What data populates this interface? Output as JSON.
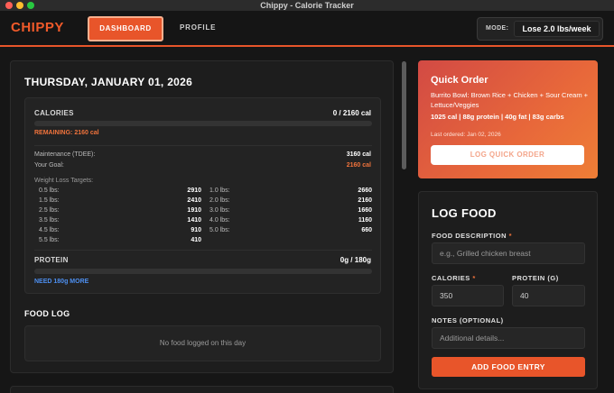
{
  "window": {
    "title": "Chippy - Calorie Tracker",
    "traffic_lights": [
      "#ff5f57",
      "#febc2e",
      "#28c840"
    ]
  },
  "header": {
    "logo": "CHIPPY",
    "nav": {
      "dashboard": "DASHBOARD",
      "profile": "PROFILE"
    },
    "mode_label": "MODE:",
    "mode_value": "Lose 2.0 lbs/week"
  },
  "dashboard": {
    "date": "THURSDAY, JANUARY 01, 2026",
    "calories": {
      "label": "CALORIES",
      "value": "0 / 2160 cal",
      "progress": 0,
      "remaining": "REMAINING: 2160 cal"
    },
    "maintenance": {
      "label": "Maintenance (TDEE):",
      "value": "3160 cal"
    },
    "goal": {
      "label": "Your Goal:",
      "value": "2160 cal"
    },
    "weight_loss": {
      "title": "Weight Loss Targets:",
      "left": [
        {
          "label": "0.5 lbs:",
          "value": "2910"
        },
        {
          "label": "1.5 lbs:",
          "value": "2410"
        },
        {
          "label": "2.5 lbs:",
          "value": "1910"
        },
        {
          "label": "3.5 lbs:",
          "value": "1410"
        },
        {
          "label": "4.5 lbs:",
          "value": "910"
        },
        {
          "label": "5.5 lbs:",
          "value": "410"
        }
      ],
      "right": [
        {
          "label": "1.0 lbs:",
          "value": "2660"
        },
        {
          "label": "2.0 lbs:",
          "value": "2160"
        },
        {
          "label": "3.0 lbs:",
          "value": "1660"
        },
        {
          "label": "4.0 lbs:",
          "value": "1160"
        },
        {
          "label": "5.0 lbs:",
          "value": "660"
        }
      ]
    },
    "protein": {
      "label": "PROTEIN",
      "value": "0g / 180g",
      "progress": 0,
      "need": "NEED 180g MORE"
    },
    "food_log": {
      "title": "FOOD LOG",
      "empty": "No food logged on this day"
    }
  },
  "quick_order": {
    "title": "Quick Order",
    "description": "Burrito Bowl: Brown Rice + Chicken + Sour Cream + Lettuce/Veggies",
    "macros": "1025 cal | 88g protein | 40g fat | 83g carbs",
    "last_ordered": "Last ordered: Jan 02, 2026",
    "button": "LOG QUICK ORDER"
  },
  "log_food": {
    "title": "LOG FOOD",
    "description_label": "FOOD DESCRIPTION",
    "description_placeholder": "e.g., Grilled chicken breast",
    "calories_label": "CALORIES",
    "calories_value": "350",
    "protein_label": "PROTEIN (G)",
    "protein_value": "40",
    "notes_label": "NOTES (OPTIONAL)",
    "notes_placeholder": "Additional details...",
    "required_mark": "*",
    "add_button": "ADD FOOD ENTRY"
  }
}
